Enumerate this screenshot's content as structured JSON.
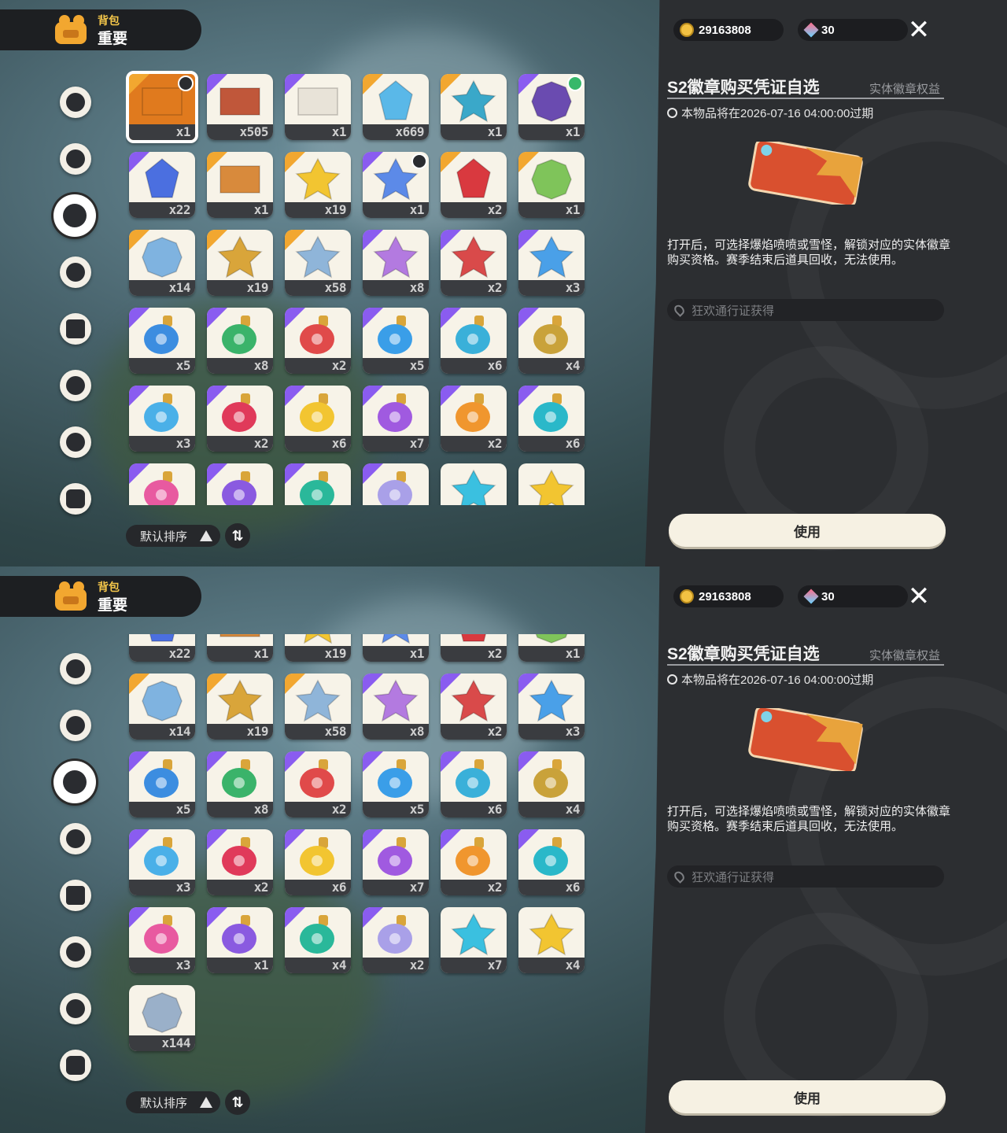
{
  "header": {
    "category_small": "背包",
    "category_big": "重要"
  },
  "sidebar": {
    "items": [
      {
        "icon": "star-badge-icon"
      },
      {
        "icon": "leaf-bloom-icon"
      },
      {
        "icon": "sparkle-gear-icon",
        "active": true
      },
      {
        "icon": "leaves-icon"
      },
      {
        "icon": "crown-card-icon"
      },
      {
        "icon": "ball-icon"
      },
      {
        "icon": "acorn-icon"
      },
      {
        "icon": "sofa-icon"
      }
    ]
  },
  "currency": {
    "coins": "29163808",
    "gems": "30"
  },
  "close_label": "✕",
  "detail": {
    "title": "S2徽章购买凭证自选",
    "tag": "实体徽章权益",
    "expire": "本物品将在2026-07-16 04:00:00过期",
    "description": "打开后，可选择爆焰喷喷或雪怪，解锁对应的实体徽章购买资格。赛季结束后道具回收，无法使用。",
    "source": "狂欢通行证获得",
    "use_label": "使用"
  },
  "sort": {
    "label": "默认排序",
    "toggle": "⇅"
  },
  "items": [
    {
      "name": "badge-voucher",
      "qty": "x1",
      "color": "#e07a1e",
      "corner": "gold",
      "badge": "dark",
      "selected": true
    },
    {
      "name": "bunny-card",
      "qty": "x505",
      "color": "#c0573a",
      "corner": "purple"
    },
    {
      "name": "ticket-card",
      "qty": "x1",
      "color": "#e8e3d8",
      "corner": "purple"
    },
    {
      "name": "prism-crystal",
      "qty": "x669",
      "color": "#5ab8e8",
      "corner": "gold"
    },
    {
      "name": "blue-bottle",
      "qty": "x1",
      "color": "#3aa8c9",
      "corner": "gold"
    },
    {
      "name": "purple-pouch",
      "qty": "x1",
      "color": "#6a4bb0",
      "corner": "purple",
      "badge": "green"
    },
    {
      "name": "blue-gem",
      "qty": "x22",
      "color": "#4b6fe0",
      "corner": "purple"
    },
    {
      "name": "gift-box",
      "qty": "x1",
      "color": "#d88a3c",
      "corner": "gold"
    },
    {
      "name": "gold-star",
      "qty": "x19",
      "color": "#f2c531",
      "corner": "gold"
    },
    {
      "name": "star-wand",
      "qty": "x1",
      "color": "#5c8ae8",
      "corner": "purple",
      "badge": "dark"
    },
    {
      "name": "red-crystal",
      "qty": "x2",
      "color": "#d9393f",
      "corner": "gold"
    },
    {
      "name": "green-charm",
      "qty": "x1",
      "color": "#7fc45a",
      "corner": "gold"
    },
    {
      "name": "blue-shell",
      "qty": "x14",
      "color": "#7fb3e0",
      "corner": "gold"
    },
    {
      "name": "gold-key",
      "qty": "x19",
      "color": "#d9a53a",
      "corner": "gold"
    },
    {
      "name": "star-wand-blue",
      "qty": "x58",
      "color": "#8fb5d9",
      "corner": "gold"
    },
    {
      "name": "rainbow-bottle",
      "qty": "x8",
      "color": "#b37ae0",
      "corner": "purple"
    },
    {
      "name": "red-potion",
      "qty": "x2",
      "color": "#d94a4a",
      "corner": "purple"
    },
    {
      "name": "blue-potion",
      "qty": "x3",
      "color": "#4aa0e8",
      "corner": "purple"
    },
    {
      "name": "potion-blue-star",
      "qty": "x5",
      "color": "#3c8de0",
      "corner": "purple"
    },
    {
      "name": "potion-green-leaf",
      "qty": "x8",
      "color": "#3ab36a",
      "corner": "purple"
    },
    {
      "name": "potion-red-flame",
      "qty": "x2",
      "color": "#e04a4a",
      "corner": "purple"
    },
    {
      "name": "potion-blue-drop",
      "qty": "x5",
      "color": "#3a9ee8",
      "corner": "purple"
    },
    {
      "name": "potion-cyan-spark",
      "qty": "x6",
      "color": "#3ab0d9",
      "corner": "purple"
    },
    {
      "name": "potion-gold-bolt",
      "qty": "x4",
      "color": "#c9a23a",
      "corner": "purple"
    },
    {
      "name": "potion-sky-flower",
      "qty": "x3",
      "color": "#4ab0e8",
      "corner": "purple"
    },
    {
      "name": "potion-red-crown",
      "qty": "x2",
      "color": "#e03a5a",
      "corner": "purple"
    },
    {
      "name": "potion-yellow-star",
      "qty": "x6",
      "color": "#f2c531",
      "corner": "purple"
    },
    {
      "name": "potion-purple-swirl",
      "qty": "x7",
      "color": "#a05ae0",
      "corner": "purple"
    },
    {
      "name": "potion-orange-sun",
      "qty": "x2",
      "color": "#f0962e",
      "corner": "purple"
    },
    {
      "name": "potion-teal-wing",
      "qty": "x6",
      "color": "#2ab8c9",
      "corner": "purple"
    },
    {
      "name": "potion-pink-heart",
      "qty": "x3",
      "color": "#e85aa0",
      "corner": "purple"
    },
    {
      "name": "potion-violet-face",
      "qty": "x1",
      "color": "#8a5ae0",
      "corner": "purple"
    },
    {
      "name": "potion-teal-gear",
      "qty": "x4",
      "color": "#2ab89a",
      "corner": "purple"
    },
    {
      "name": "potion-lilac-swirl",
      "qty": "x2",
      "color": "#a9a0e8",
      "corner": "purple"
    },
    {
      "name": "cyan-star-token",
      "qty": "x7",
      "color": "#3ac0e0",
      "corner": "none"
    },
    {
      "name": "gold-star-token",
      "qty": "x4",
      "color": "#f2c531",
      "corner": "none"
    },
    {
      "name": "silver-coin",
      "qty": "x144",
      "color": "#9ab0c9",
      "corner": "none"
    }
  ]
}
